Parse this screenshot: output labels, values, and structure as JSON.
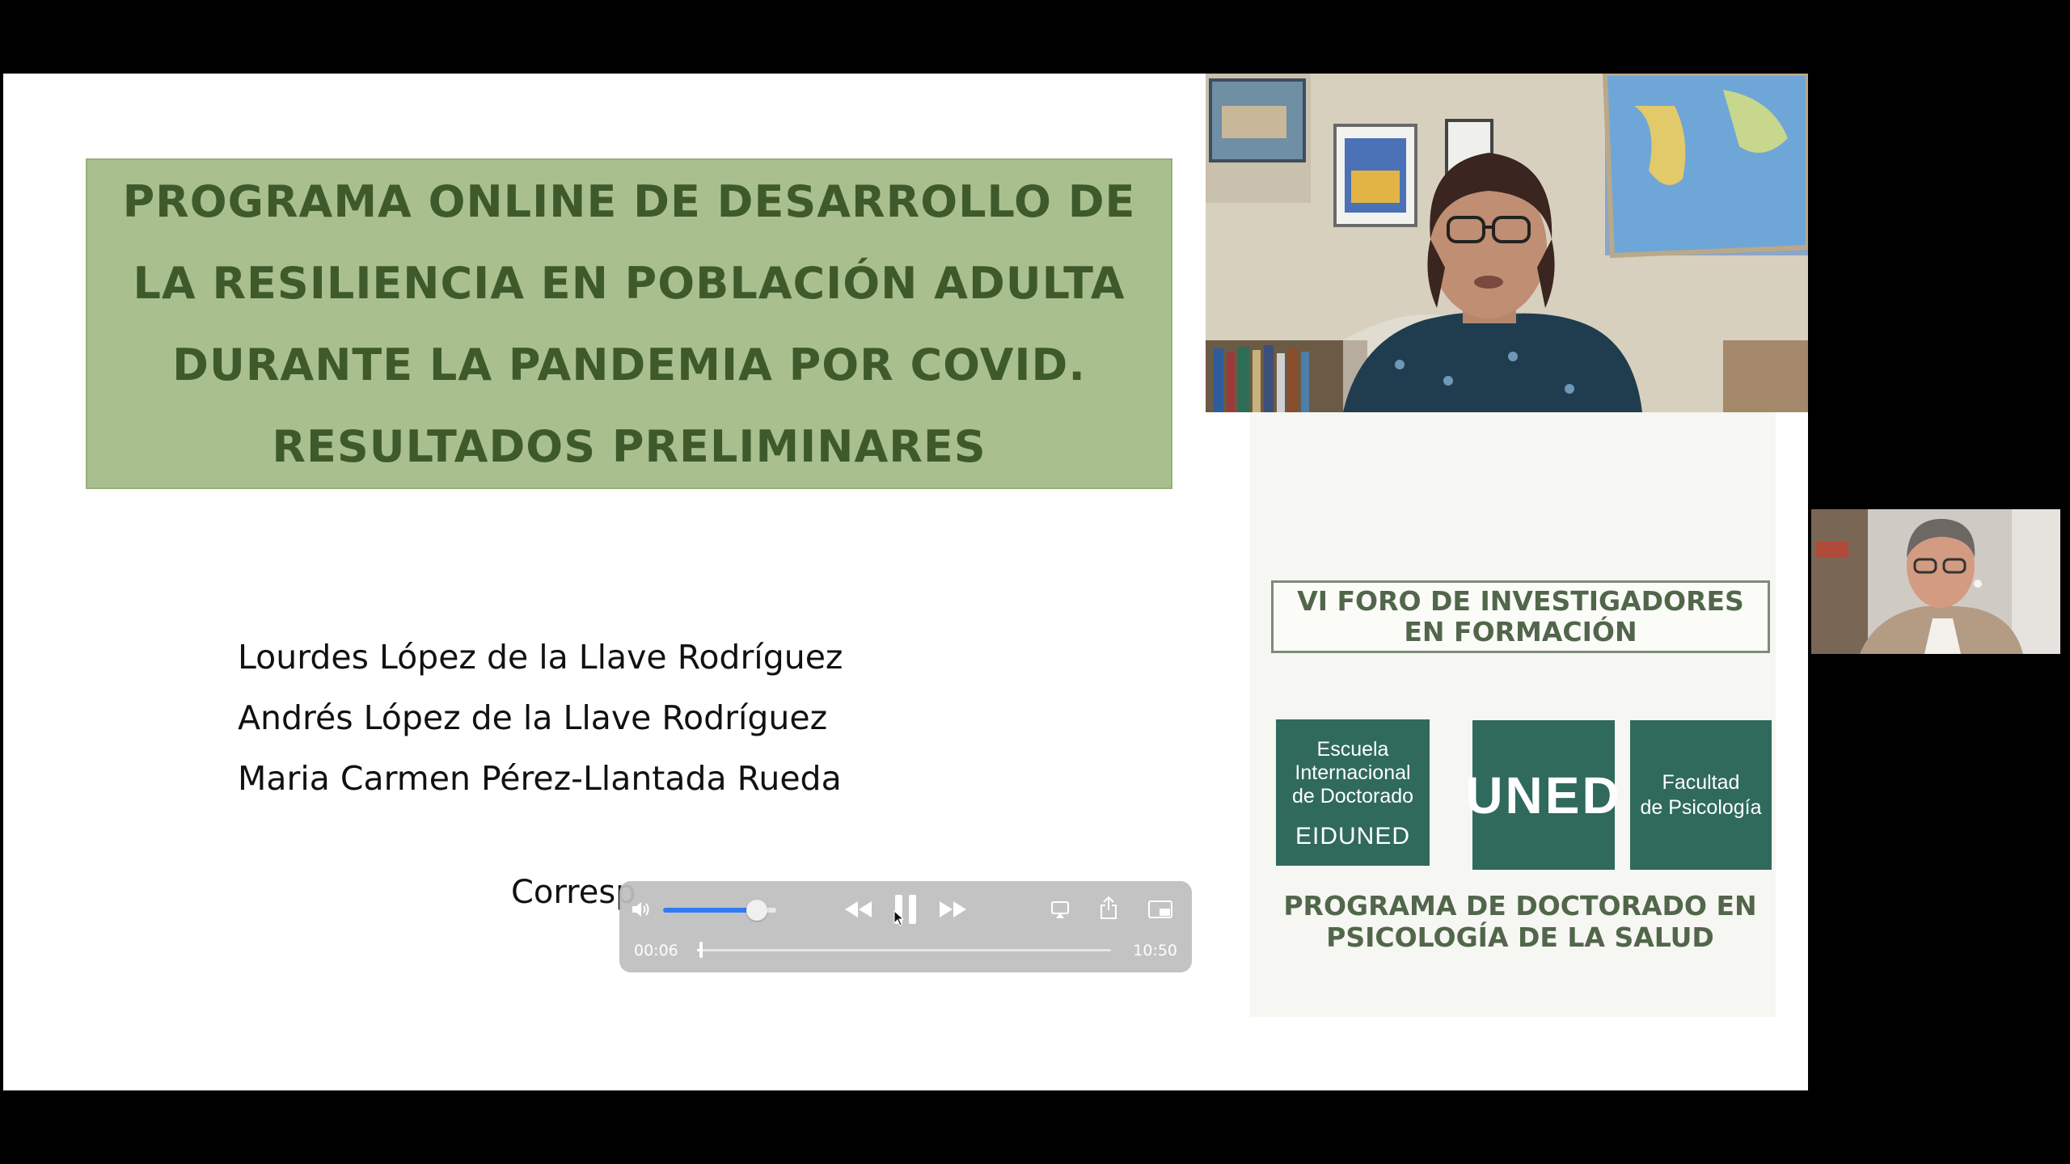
{
  "slide": {
    "title": "PROGRAMA ONLINE DE DESARROLLO DE\nLA RESILIENCIA EN POBLACIÓN ADULTA\nDURANTE LA PANDEMIA POR COVID.\nRESULTADOS PRELIMINARES",
    "authors": [
      "Lourdes López de la Llave Rodríguez",
      "Andrés López de la Llave Rodríguez",
      "Maria Carmen Pérez-Llantada Rueda"
    ],
    "correspondence": "Corresp",
    "foro_line1": "VI FORO DE INVESTIGADORES",
    "foro_line2": "EN FORMACIÓN",
    "logo_eiduned_line1": "Escuela",
    "logo_eiduned_line2": "Internacional",
    "logo_eiduned_line3": "de Doctorado",
    "logo_eiduned_name": "EIDUNED",
    "logo_uned": "UNED",
    "logo_facultad_line1": "Facultad",
    "logo_facultad_line2": "de Psicología",
    "programa_line1": "PROGRAMA DE DOCTORADO EN",
    "programa_line2": "PSICOLOGÍA DE LA SALUD"
  },
  "player": {
    "current_time": "00:06",
    "duration": "10:50",
    "volume_fraction": 0.83,
    "progress_fraction": 0.009,
    "icons": [
      "volume-icon",
      "rewind-icon",
      "pause-icon",
      "fast-forward-icon",
      "airplay-icon",
      "share-icon",
      "picture-in-picture-icon"
    ]
  },
  "colors": {
    "title_box": "#a9c08e",
    "title_text": "#3e5a2b",
    "logo_green": "#2f6a5c",
    "accent_blue": "#2f7cf6"
  }
}
